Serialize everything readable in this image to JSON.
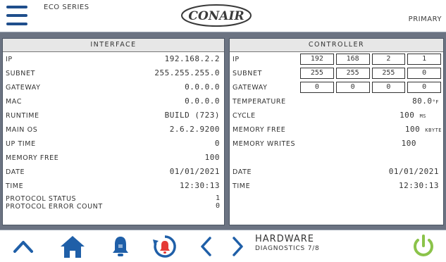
{
  "header": {
    "series": "ECO SERIES",
    "logo_text": "CONAIR",
    "mode": "PRIMARY"
  },
  "interface": {
    "title": "INTERFACE",
    "rows": [
      {
        "label": "IP",
        "value": "192.168.2.2"
      },
      {
        "label": "SUBNET",
        "value": "255.255.255.0"
      },
      {
        "label": "GATEWAY",
        "value": "0.0.0.0"
      },
      {
        "label": "MAC",
        "value": "0.0.0.0"
      },
      {
        "label": "RUNTIME",
        "value": "BUILD (723)"
      },
      {
        "label": "MAIN OS",
        "value": "2.6.2.9200"
      },
      {
        "label": "UP TIME",
        "value": "0"
      },
      {
        "label": "MEMORY FREE",
        "value": "100"
      },
      {
        "label": "DATE",
        "value": "01/01/2021"
      },
      {
        "label": "TIME",
        "value": "12:30:13"
      }
    ],
    "protocol_status_label": "PROTOCOL STATUS",
    "protocol_status_value": "1",
    "protocol_error_label": "PROTOCOL ERROR COUNT",
    "protocol_error_value": "0"
  },
  "controller": {
    "title": "CONTROLLER",
    "ip_label": "IP",
    "ip": [
      "192",
      "168",
      "2",
      "1"
    ],
    "subnet_label": "SUBNET",
    "subnet": [
      "255",
      "255",
      "255",
      "0"
    ],
    "gateway_label": "GATEWAY",
    "gateway": [
      "0",
      "0",
      "0",
      "0"
    ],
    "temperature_label": "TEMPERATURE",
    "temperature_value": "80.0",
    "temperature_unit": "°F",
    "cycle_label": "CYCLE",
    "cycle_value": "100",
    "cycle_unit": "MS",
    "memfree_label": "MEMORY FREE",
    "memfree_value": "100",
    "memfree_unit": "KBYTE",
    "memwrites_label": "MEMORY WRITES",
    "memwrites_value": "100",
    "date_label": "DATE",
    "date_value": "01/01/2021",
    "time_label": "TIME",
    "time_value": "12:30:13"
  },
  "footer": {
    "page_title": "HARDWARE",
    "page_subtitle": "DIAGNOSTICS 7/8"
  },
  "colors": {
    "nav_blue": "#1f5fa8",
    "alarm_red": "#e53935",
    "power_green": "#8bc34a",
    "panel_bg": "#6b7382"
  }
}
